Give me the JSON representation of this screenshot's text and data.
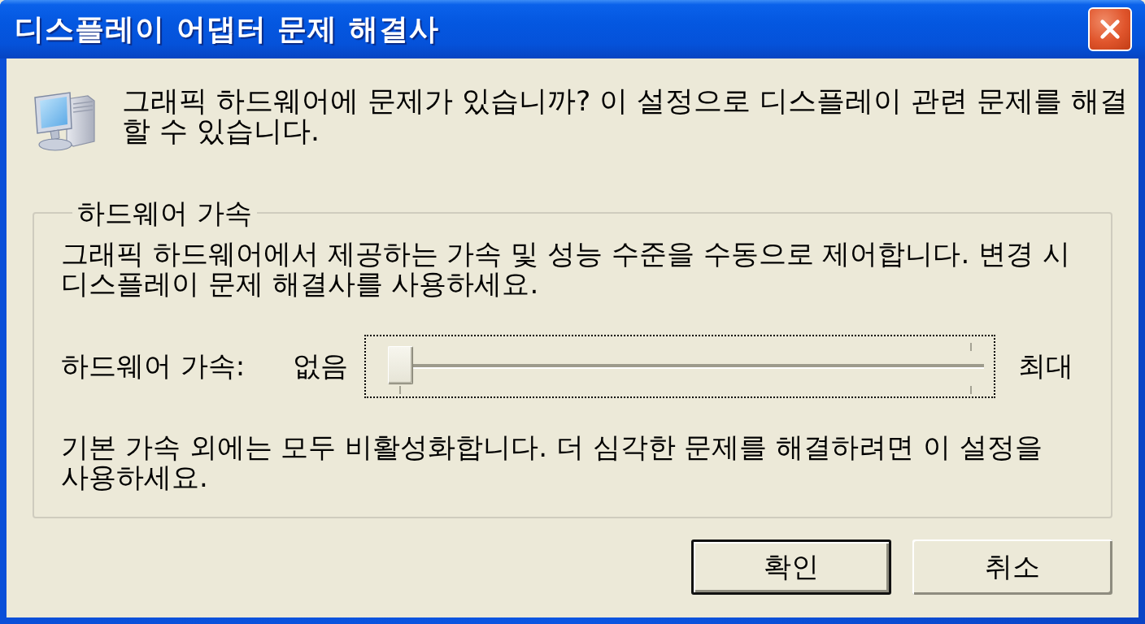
{
  "window": {
    "title": "디스플레이 어댑터 문제 해결사"
  },
  "intro": "그래픽 하드웨어에 문제가 있습니까? 이 설정으로 디스플레이 관련 문제를 해결할 수 있습니다.",
  "group": {
    "title": "하드웨어 가속",
    "description": "그래픽 하드웨어에서 제공하는 가속 및 성능 수준을 수동으로 제어합니다. 변경 시 디스플레이 문제 해결사를 사용하세요.",
    "slider": {
      "label": "하드웨어 가속:",
      "min_label": "없음",
      "max_label": "최대",
      "level": 0,
      "focused": true
    },
    "note": "기본 가속 외에는 모두 비활성화합니다. 더 심각한 문제를 해결하려면 이 설정을 사용하세요."
  },
  "buttons": [
    {
      "label": "확인",
      "default": true
    },
    {
      "label": "취소",
      "default": false
    }
  ]
}
